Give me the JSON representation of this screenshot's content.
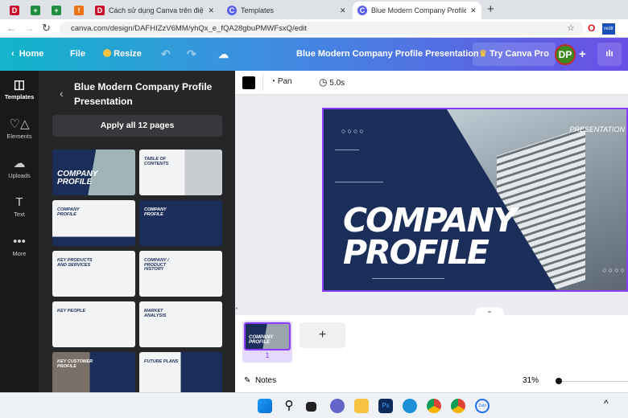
{
  "browser": {
    "tabs": [
      {
        "label": "",
        "icon": "red-d-icon"
      },
      {
        "label": "",
        "icon": "green-sheet-icon"
      },
      {
        "label": "",
        "icon": "green-sheet-icon"
      },
      {
        "label": "",
        "icon": "orange-icon"
      },
      {
        "label": "Cách sử dụng Canva trên điện th",
        "icon": "red-d-icon"
      },
      {
        "label": "Templates",
        "icon": "canva-icon"
      },
      {
        "label": "Blue Modern Company Profile Pr",
        "icon": "canva-icon",
        "active": true
      }
    ],
    "url": "canva.com/design/DAFHIZzV6MM/yhQx_e_fQA28gbuPMWFsxQ/edit"
  },
  "header": {
    "home": "Home",
    "file": "File",
    "resize": "Resize",
    "title": "Blue Modern Company Profile Presentation",
    "try_pro": "Try Canva Pro",
    "avatar": "DP"
  },
  "rail": [
    {
      "label": "Templates",
      "icon": "templates-icon"
    },
    {
      "label": "Elements",
      "icon": "elements-icon"
    },
    {
      "label": "Uploads",
      "icon": "upload-icon"
    },
    {
      "label": "Text",
      "icon": "text-icon"
    },
    {
      "label": "More",
      "icon": "more-icon"
    }
  ],
  "panel": {
    "title": "Blue Modern Company Profile Presentation",
    "apply": "Apply all 12 pages",
    "thumbs": [
      "COMPANY PROFILE",
      "TABLE OF CONTENTS",
      "COMPANY PROFILE",
      "COMPANY PROFILE",
      "KEY PRODUCTS AND SERVICES",
      "COMPANY / PRODUCT HISTORY",
      "KEY PEOPLE",
      "MARKET ANALYSIS",
      "KEY CUSTOMER PROFILE",
      "FUTURE PLANS"
    ]
  },
  "toolbar": {
    "pan": "Pan",
    "duration": "5.0s",
    "color": "#000000"
  },
  "slide": {
    "title1": "COMPANY",
    "title2": "PROFILE",
    "tag": "PRESENTATION"
  },
  "film": {
    "page": "1",
    "add": "+"
  },
  "footer": {
    "notes": "Notes",
    "zoom": "31%",
    "zoom_value": 31
  },
  "colors": {
    "accent": "#8b3dff",
    "navy": "#1b2e5a"
  }
}
